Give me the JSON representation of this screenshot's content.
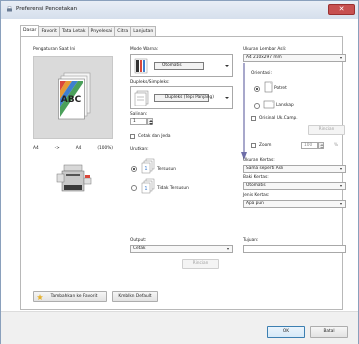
{
  "window": {
    "title": "Preferensi Pencetakan"
  },
  "tabs": [
    "Dasar",
    "Favorit",
    "Tata Letak",
    "Pnyelesai",
    "Citra",
    "Lanjutan"
  ],
  "preview": {
    "title": "Pengaturan Saat Ini",
    "summary": [
      "A4",
      "->",
      "A4",
      "(100%)"
    ]
  },
  "color_mode": {
    "label": "Mode Warna:",
    "value": "Otomatis"
  },
  "duplex": {
    "label": "Dupleks/Simpleks:",
    "value": "Dupleks (Tepi Panjang)"
  },
  "copies": {
    "label": "Salinan:",
    "value": "1"
  },
  "print_and_pause": {
    "label": "Cetak dan Jeda",
    "checked": false
  },
  "sort": {
    "label": "Urutkan:",
    "options": [
      "Tersusun",
      "Tidak Tersusun"
    ],
    "selected": "Tersusun"
  },
  "original_size": {
    "label": "Ukuran Lembar Asli:",
    "value": "A4 210x297 mm"
  },
  "orientation": {
    "label": "Orientasi:",
    "options": [
      "Potret",
      "Lanskap"
    ],
    "selected": "Potret"
  },
  "mixed_original": {
    "label": "Orisinal Uk.Camp.",
    "checked": false
  },
  "detail_button": "Rincian",
  "zoom": {
    "label": "Zoom",
    "checked": false,
    "value": "100",
    "unit": "%"
  },
  "paper_size": {
    "label": "Ukuran Kertas:",
    "value": "Sama seperti Asli"
  },
  "paper_tray": {
    "label": "Baki Kertas:",
    "value": "Otomatis"
  },
  "paper_type": {
    "label": "Jenis Kertas:",
    "value": "Apa pun"
  },
  "output": {
    "label": "Output:",
    "value": "Cetak",
    "detail_button": "Rincian"
  },
  "destination": {
    "label": "Tujuan:",
    "value": ""
  },
  "footer": {
    "add_favorite": "Tambahkan ke Favorit",
    "restore_default": "Kmblkn Default",
    "ok": "OK",
    "cancel": "Batal"
  }
}
